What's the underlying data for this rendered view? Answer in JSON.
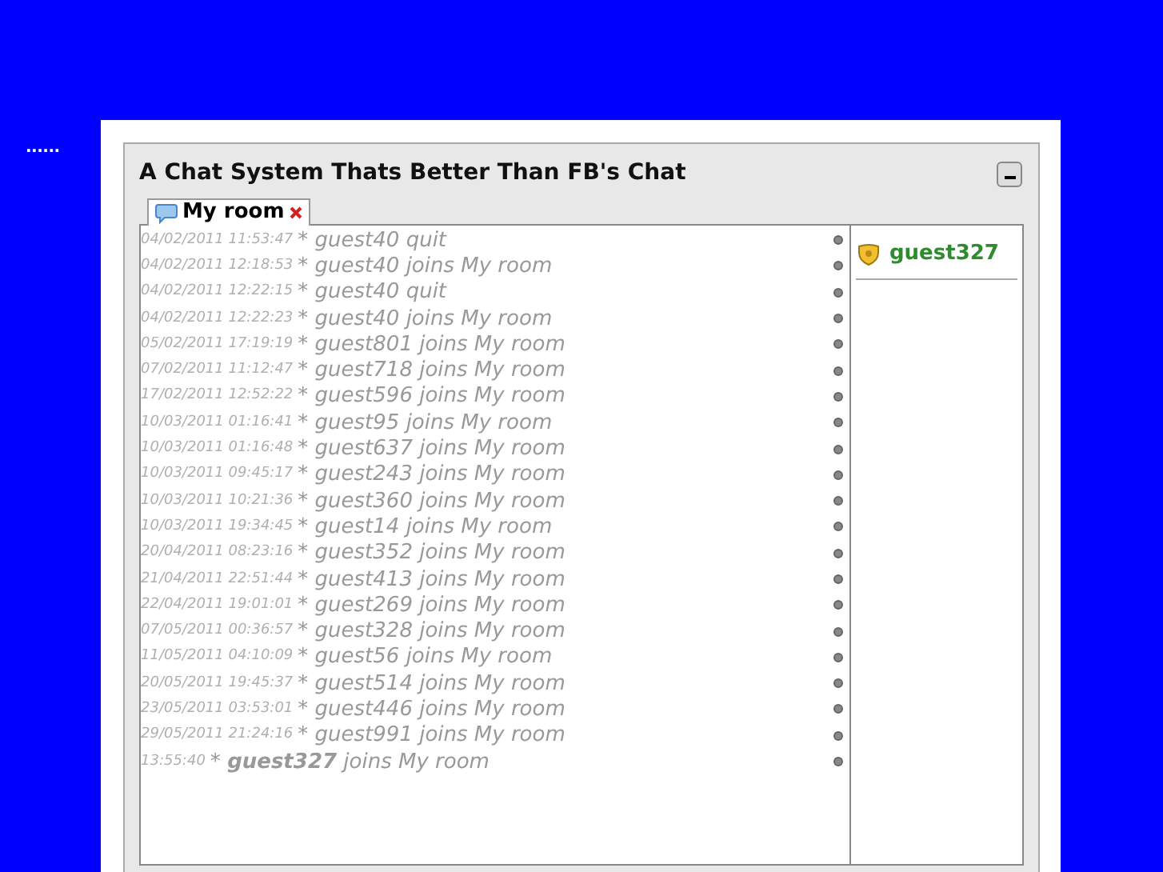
{
  "nav_dots": "......",
  "window": {
    "title": "A Chat System Thats Better Than FB's Chat"
  },
  "tabs": [
    {
      "label": "My room",
      "selected": true
    }
  ],
  "messages": [
    {
      "time": "04/02/2011 11:53:47",
      "text": "* guest40 quit"
    },
    {
      "time": "04/02/2011 12:18:53",
      "text": "* guest40 joins My room"
    },
    {
      "time": "04/02/2011 12:22:15",
      "text": "* guest40 quit"
    },
    {
      "time": "04/02/2011 12:22:23",
      "text": "* guest40 joins My room"
    },
    {
      "time": "05/02/2011 17:19:19",
      "text": "* guest801 joins My room"
    },
    {
      "time": "07/02/2011 11:12:47",
      "text": "* guest718 joins My room"
    },
    {
      "time": "17/02/2011 12:52:22",
      "text": "* guest596 joins My room"
    },
    {
      "time": "10/03/2011 01:16:41",
      "text": "* guest95 joins My room"
    },
    {
      "time": "10/03/2011 01:16:48",
      "text": "* guest637 joins My room"
    },
    {
      "time": "10/03/2011 09:45:17",
      "text": "* guest243 joins My room"
    },
    {
      "time": "10/03/2011 10:21:36",
      "text": "* guest360 joins My room"
    },
    {
      "time": "10/03/2011 19:34:45",
      "text": "* guest14 joins My room"
    },
    {
      "time": "20/04/2011 08:23:16",
      "text": "* guest352 joins My room"
    },
    {
      "time": "21/04/2011 22:51:44",
      "text": "* guest413 joins My room"
    },
    {
      "time": "22/04/2011 19:01:01",
      "text": "* guest269 joins My room"
    },
    {
      "time": "07/05/2011 00:36:57",
      "text": "* guest328 joins My room"
    },
    {
      "time": "11/05/2011 04:10:09",
      "text": "* guest56 joins My room"
    },
    {
      "time": "20/05/2011 19:45:37",
      "text": "* guest514 joins My room"
    },
    {
      "time": "23/05/2011 03:53:01",
      "text": "* guest446 joins My room"
    },
    {
      "time": "29/05/2011 21:24:16",
      "text": "* guest991 joins My room"
    },
    {
      "time": "13:55:40",
      "text": "* **guest327** joins My room"
    }
  ],
  "users": [
    {
      "name": "guest327"
    }
  ]
}
